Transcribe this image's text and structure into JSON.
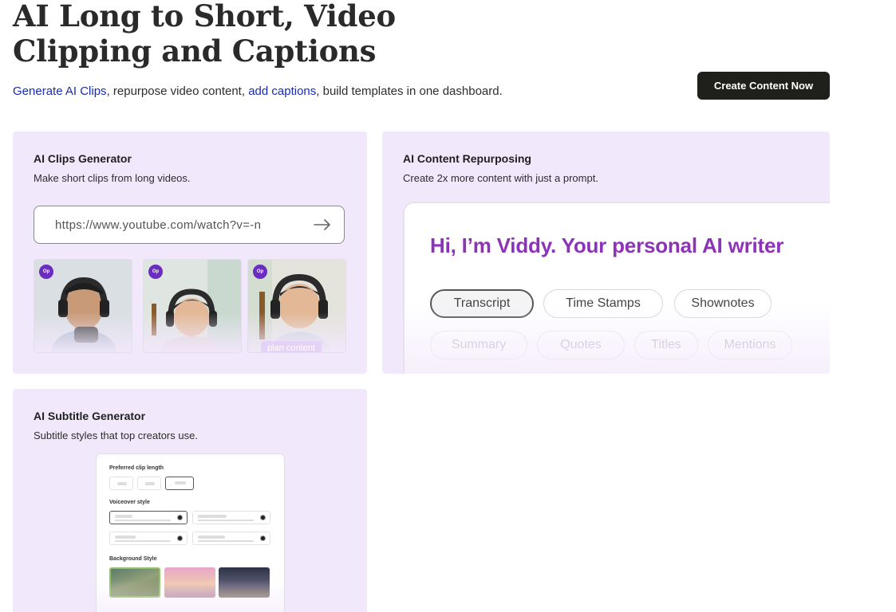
{
  "hero": {
    "title_line1": "AI Long to Short, Video",
    "title_line2": "Clipping and Captions",
    "subtitle": {
      "link1": "Generate AI Clips",
      "text1": ", repurpose video content, ",
      "link2": "add captions",
      "text2": ", build templates in one dashboard."
    },
    "cta_label": "Create Content Now"
  },
  "cards": {
    "clips": {
      "title": "AI Clips Generator",
      "description": "Make short clips from long videos.",
      "url_value": "https://www.youtube.com/watch?v=-n",
      "thumbnail_badge": "Op",
      "thumbnail_tag": "plan content"
    },
    "repurpose": {
      "title": "AI Content Repurposing",
      "description": "Create 2x more content with just a prompt.",
      "heading": "Hi, I’m Viddy. Your personal AI writer",
      "chips": [
        "Transcript",
        "Time Stamps",
        "Shownotes"
      ],
      "chips_faded": [
        "Summary",
        "Quotes",
        "Titles",
        "Mentions"
      ]
    },
    "subtitle": {
      "title": "AI Subtitle Generator",
      "description": "Subtitle styles that top creators use.",
      "preferred_clip_length_label": "Preferred clip length",
      "voiceover_style_label": "Voiceover style",
      "background_style_label": "Background Style"
    }
  },
  "colors": {
    "card_bg": "#f2e8fb",
    "cta_bg": "#1f1f1c",
    "link": "#1a2bb5",
    "viddy_heading": "#8d33b7",
    "badge": "#6a2dbf"
  }
}
